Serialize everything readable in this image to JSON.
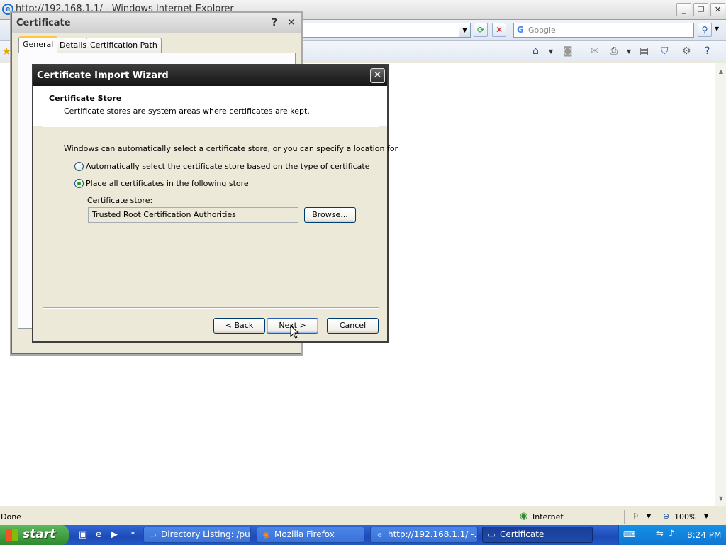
{
  "ie": {
    "title": "http://192.168.1.1/ - Windows Internet Explorer",
    "search_placeholder": "Google",
    "status_text": "Done",
    "zone": "Internet",
    "zoom": "100%"
  },
  "certificate_dialog": {
    "title": "Certificate",
    "tabs": [
      {
        "label": "General",
        "selected": true
      },
      {
        "label": "Details",
        "selected": false
      },
      {
        "label": "Certification Path",
        "selected": false
      }
    ]
  },
  "wizard": {
    "title": "Certificate Import Wizard",
    "header_title": "Certificate Store",
    "header_subtitle": "Certificate stores are system areas where certificates are kept.",
    "intro": "Windows can automatically select a certificate store, or you can specify a location for",
    "options": [
      {
        "label": "Automatically select the certificate store based on the type of certificate",
        "selected": false
      },
      {
        "label": "Place all certificates in the following store",
        "selected": true
      }
    ],
    "store_label": "Certificate store:",
    "store_value": "Trusted Root Certification Authorities",
    "browse_label": "Browse...",
    "back_label": "< Back",
    "next_label": "Next >",
    "cancel_label": "Cancel"
  },
  "taskbar": {
    "start_label": "start",
    "tasks": [
      {
        "label": "Directory Listing: /pu...",
        "active": false
      },
      {
        "label": "Mozilla Firefox",
        "active": false
      },
      {
        "label": "http://192.168.1.1/ -...",
        "active": false
      },
      {
        "label": "Certificate",
        "active": true
      }
    ],
    "clock": "8:24 PM"
  },
  "colors": {
    "taskbar": "#245edb",
    "start": "#3c9a3c",
    "wizard_title": "#1f1f1f",
    "radio_dot": "#21a121"
  }
}
